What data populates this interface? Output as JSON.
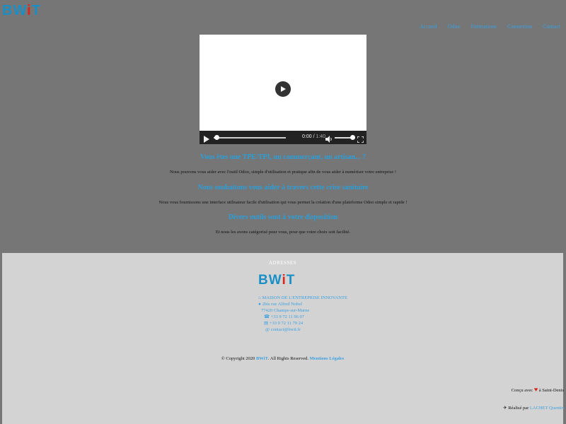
{
  "logo": {
    "b": "B",
    "w": "W",
    "i": "i",
    "t": "T"
  },
  "nav": [
    {
      "label": "Accueil"
    },
    {
      "label": "Odoo"
    },
    {
      "label": "Formations"
    },
    {
      "label": "Connexion"
    },
    {
      "label": "Contact"
    }
  ],
  "video": {
    "time_current": "0:00",
    "time_total": "1:40",
    "progress": 0.0,
    "volume": 1.0
  },
  "content": {
    "h1": "Vous êtes une TPE/TPI, un commerçant, un artisan... ?",
    "p1": "Nous pouvons vous aider avec l'outil Odoo, simple d'utilisation et pratique afin de vous aider à numériser votre entreprise !",
    "h2": "Nous souhaitons vous aider à travers cette crise sanitaire",
    "p2": "Nous vous fournissons une interface utilisateur facile d'utilisation qui vous permet la création d'une plateforme Odoo simple et rapide !",
    "h3": "Divers outils sont à votre disposition",
    "p3": "Et nous les avons catégorisé pour vous, pour que votre choix soit facilité."
  },
  "footer": {
    "address_title": "ADRESSES",
    "address_lines": {
      "org": "MAISON DE L'ENTREPRISE INNOVANTE",
      "street": "2bis rue Alfred Nobel",
      "city": "77420 Champs-sur-Marne",
      "phone": "+33 9 72 11 96 07",
      "fax": "+33 9 72 11 79 24",
      "email": "contact@bwit.fr"
    },
    "copyright_prefix": "© Copyright 2020",
    "copyright_brand": "BWiT",
    "copyright_suffix": ". All Rights Reserved.",
    "legal_link": "Mentions Légales",
    "made_prefix": "Conçu avec",
    "made_suffix": "à Saint-Denis",
    "by_prefix": "Réalisé par",
    "by_name": "LACHET Quentin"
  },
  "colors": {
    "accent": "#2c9ed8",
    "logo_red": "#d9261c",
    "background": "#767676",
    "footer": "#d3d3d3"
  }
}
